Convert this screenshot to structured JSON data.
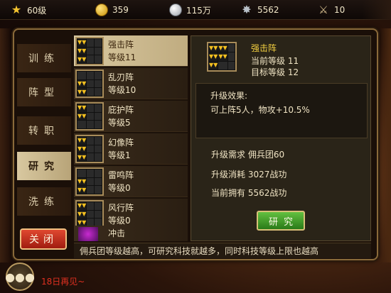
{
  "topbar": {
    "level": "60级",
    "gold": "359",
    "silver": "115万",
    "merit": "5562",
    "stamina": "10"
  },
  "tabs": [
    {
      "label": "训练"
    },
    {
      "label": "阵型"
    },
    {
      "label": "转职"
    },
    {
      "label": "研究"
    },
    {
      "label": "洗练"
    }
  ],
  "close_label": "关闭",
  "list": [
    {
      "name": "强击阵",
      "level": "等级11"
    },
    {
      "name": "乱刃阵",
      "level": "等级10"
    },
    {
      "name": "庇护阵",
      "level": "等级5"
    },
    {
      "name": "幻像阵",
      "level": "等级1"
    },
    {
      "name": "雷鸣阵",
      "level": "等级0"
    },
    {
      "name": "风行阵",
      "level": "等级0"
    }
  ],
  "partial_item": {
    "name": "冲击"
  },
  "detail": {
    "name": "强击阵",
    "current_level": "当前等级 11",
    "target_level": "目标等级 12",
    "effect_title": "升级效果:",
    "effect_text": "可上阵5人，物攻+10.5%",
    "req_need": "升级需求  佣兵团60",
    "req_cost": "升级消耗  3027战功",
    "req_have": "当前拥有  5562战功",
    "research_label": "研究"
  },
  "tip": "佣兵团等级越高，可研究科技就越多，同时科技等级上限也越高",
  "chat": {
    "icon": "chat-bubble-icon",
    "message": "18日再见~"
  },
  "colors": {
    "active_tab": "#c8b888",
    "close_button": "#c8301c",
    "research_button": "#4aa02c",
    "highlight_name": "#f4d040"
  }
}
